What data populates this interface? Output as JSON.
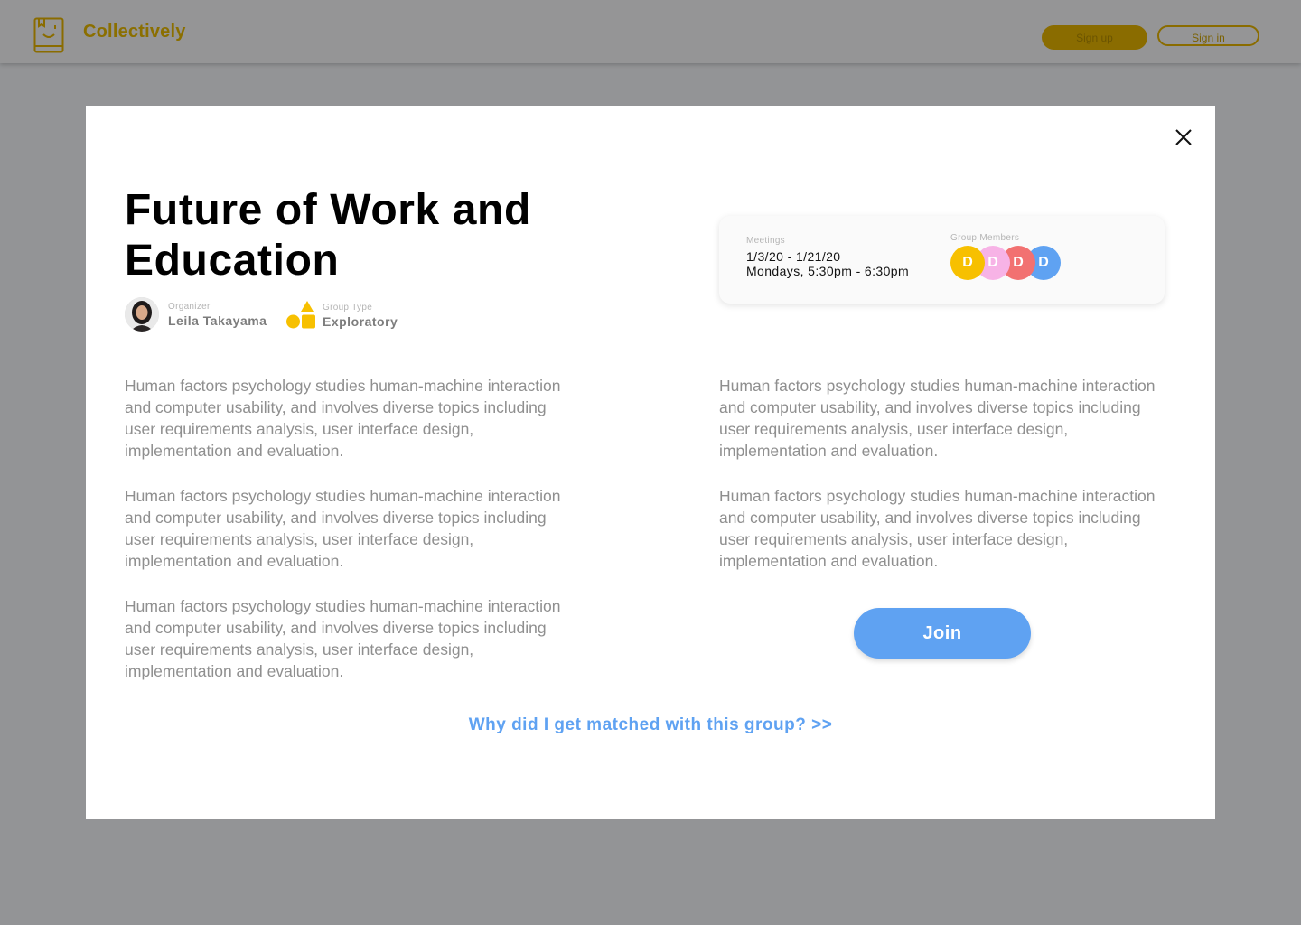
{
  "header": {
    "brand": "Collectively",
    "logo_icon": "book-smile-icon",
    "signup_label": "Sign up",
    "signin_label": "Sign in"
  },
  "modal": {
    "close_icon": "close-icon",
    "title": "Future of Work and Education",
    "organizer": {
      "label": "Organizer",
      "name": "Leila Takayama"
    },
    "group_type": {
      "label": "Group Type",
      "value": "Exploratory",
      "icon": "shapes-icon"
    },
    "info_card": {
      "meetings_label": "Meetings",
      "dates": "1/3/20 - 1/21/20",
      "schedule": "Mondays, 5:30pm - 6:30pm",
      "members_label": "Group Members",
      "members": [
        {
          "initial": "D",
          "color": "#f7c000"
        },
        {
          "initial": "D",
          "color": "#f7b3e6"
        },
        {
          "initial": "D",
          "color": "#f27171"
        },
        {
          "initial": "D",
          "color": "#5fa2f2"
        }
      ]
    },
    "left_paragraphs": [
      "Human factors psychology studies human-machine interaction and computer usability, and involves diverse topics including user requirements analysis, user interface design, implementation and evaluation.",
      "Human factors psychology studies human-machine interaction and computer usability, and involves diverse topics including user requirements analysis, user interface design, implementation and evaluation.",
      "Human factors psychology studies human-machine interaction and computer usability, and involves diverse topics including user requirements analysis, user interface design, implementation and evaluation."
    ],
    "right_paragraphs": [
      "Human factors psychology studies human-machine interaction and computer usability, and involves diverse topics including user requirements analysis, user interface design, implementation and evaluation.",
      "Human factors psychology studies human-machine interaction and computer usability, and involves diverse topics including user requirements analysis, user interface design, implementation and evaluation."
    ],
    "join_label": "Join",
    "why_link": "Why did I get matched with this group? >>"
  },
  "colors": {
    "brand_gold": "#f7c000",
    "accent_blue": "#5fa2f2",
    "overlay": "#939496"
  }
}
